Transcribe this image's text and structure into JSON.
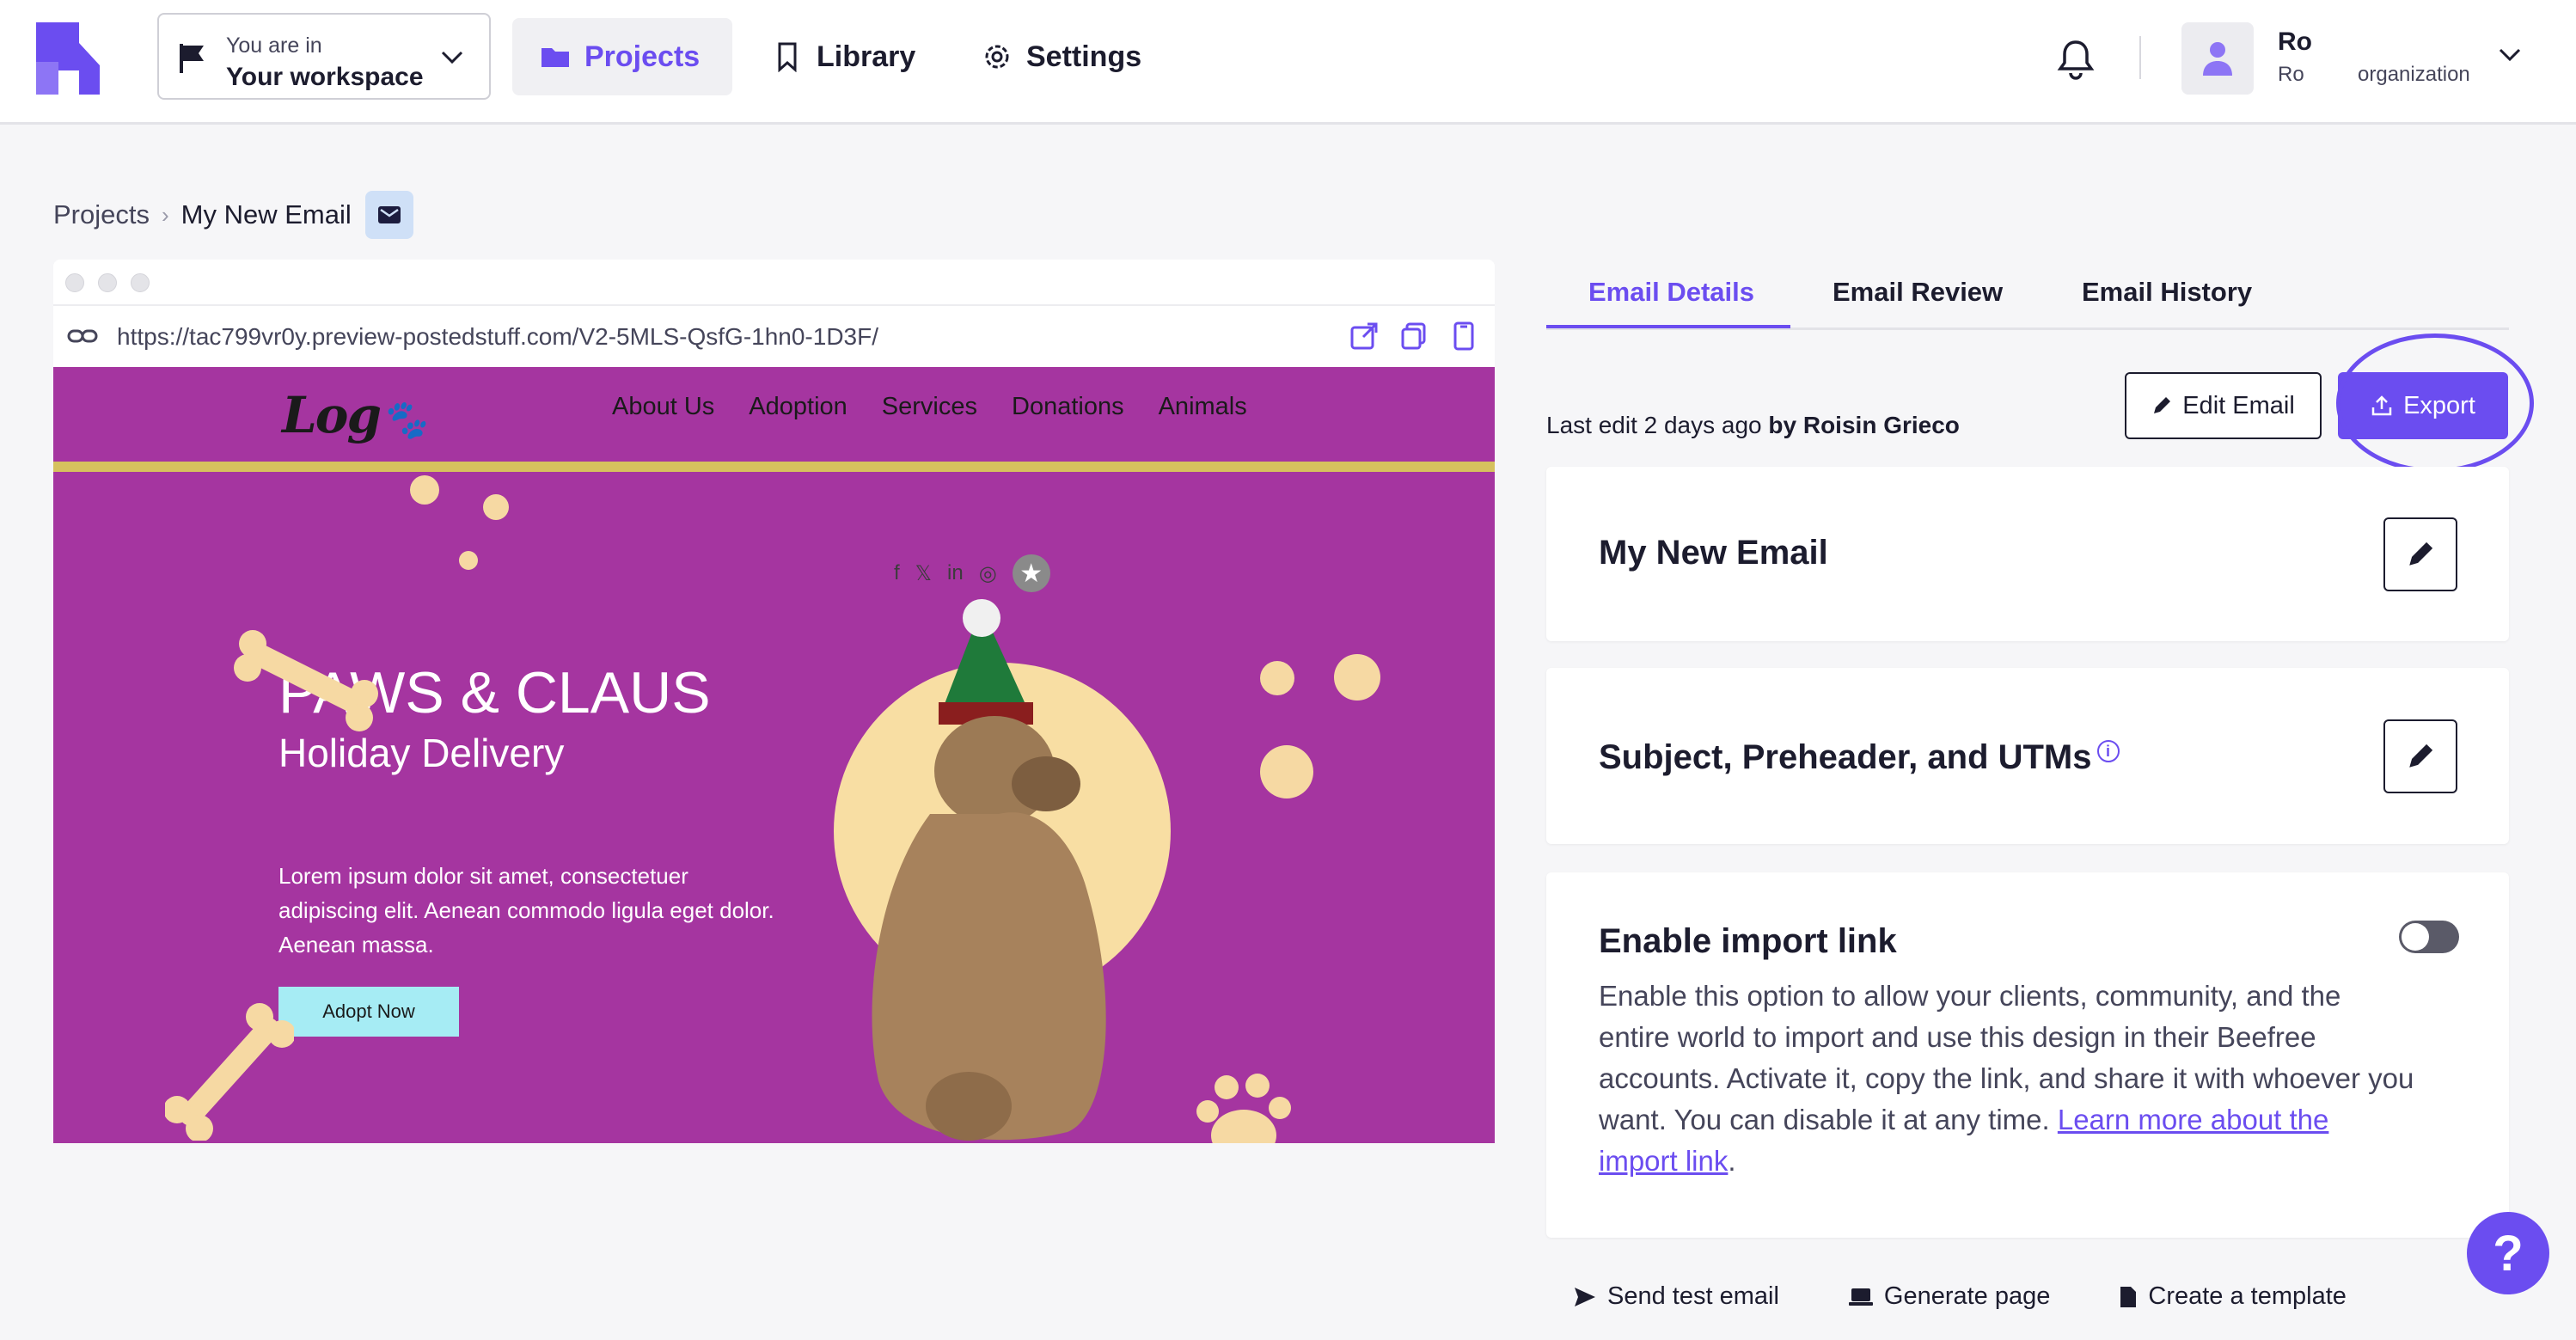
{
  "topbar": {
    "workspace_label": "You are in",
    "workspace_value": "Your workspace",
    "nav": {
      "projects": "Projects",
      "library": "Library",
      "settings": "Settings"
    },
    "user": {
      "name": "Ro",
      "sub": "Ro",
      "org": "organization"
    }
  },
  "breadcrumb": {
    "root": "Projects",
    "current": "My New Email"
  },
  "preview": {
    "url": "https://tac799vr0y.preview-postedstuff.com/V2-5MLS-QsfG-1hn0-1D3F/",
    "email": {
      "logo": "Log",
      "nav": [
        "About Us",
        "Adoption",
        "Services",
        "Donations",
        "Animals"
      ],
      "social": [
        "f",
        "𝕏",
        "in",
        "◎"
      ],
      "title": "PAWS & CLAUS",
      "subtitle": "Holiday Delivery",
      "body": "Lorem ipsum dolor sit amet, consectetuer adipiscing elit. Aenean commodo ligula eget dolor. Aenean massa.",
      "cta": "Adopt Now"
    }
  },
  "panel": {
    "tabs": [
      "Email Details",
      "Email Review",
      "Email History"
    ],
    "last_edit_prefix": "Last edit 2 days ago",
    "last_edit_by": "by Roisin Grieco",
    "edit_email": "Edit Email",
    "export": "Export",
    "card_name": "My New Email",
    "card_subject": "Subject, Preheader, and UTMs",
    "card_import_title": "Enable import link",
    "card_import_desc": "Enable this option to allow your clients, community, and the entire world to import and use this design in their Beefree accounts. Activate it, copy the link, and share it with whoever you want. You can disable it at any time. ",
    "card_import_link": "Learn more about the import link",
    "card_import_toggle_on": false,
    "actions": {
      "send_test": "Send test email",
      "generate_page": "Generate page",
      "create_template": "Create a template"
    },
    "help": "?"
  },
  "colors": {
    "accent": "#6b4df0",
    "email_bg": "#a535a0",
    "stripe": "#d6c15e",
    "cta": "#a6ecf4"
  }
}
